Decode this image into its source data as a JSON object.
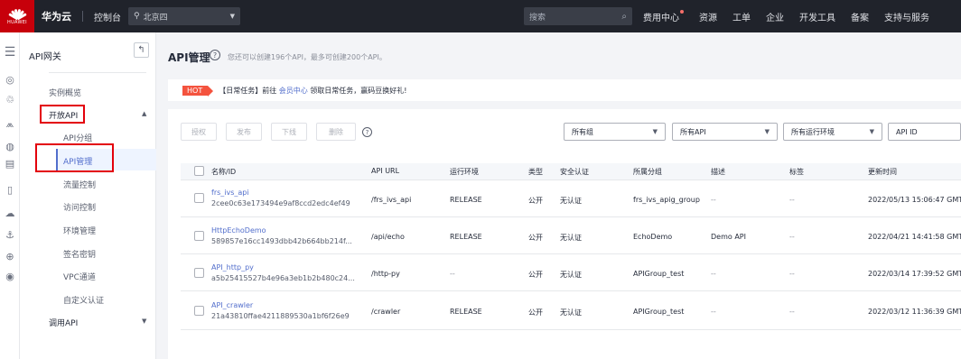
{
  "topbar": {
    "logo_text": "HUAWEI",
    "brand": "华为云",
    "console": "控制台",
    "region": "北京四",
    "search_placeholder": "搜索",
    "links": [
      "费用中心",
      "资源",
      "工单",
      "企业",
      "开发工具",
      "备案",
      "支持与服务"
    ]
  },
  "nav": {
    "title": "API网关",
    "items": {
      "overview": "实例概览",
      "open_api": "开放API",
      "api_group": "API分组",
      "api_manage": "API管理",
      "throttle": "流量控制",
      "access_control": "访问控制",
      "env_manage": "环境管理",
      "signature": "签名密钥",
      "vpc_channel": "VPC通道",
      "custom_auth": "自定义认证",
      "call_api": "调用API"
    }
  },
  "page": {
    "title": "API管理",
    "subtitle": "您还可以创建196个API，最多可创建200个API。"
  },
  "notice": {
    "badge": "HOT",
    "prefix": "【日常任务】前往",
    "link": "会员中心",
    "suffix": "领取日常任务，赢码豆换好礼!"
  },
  "toolbar": {
    "authorize": "授权",
    "publish": "发布",
    "offline": "下线",
    "delete": "删除"
  },
  "filters": {
    "group": "所有组",
    "api": "所有API",
    "env": "所有运行环境",
    "field": "API ID"
  },
  "table": {
    "headers": [
      "名称/ID",
      "API URL",
      "运行环境",
      "类型",
      "安全认证",
      "所属分组",
      "描述",
      "标签",
      "更新时间"
    ],
    "rows": [
      {
        "name": "frs_ivs_api",
        "id": "2cee0c63e173494e9af8ccd2edc4ef49",
        "url": "/frs_ivs_api",
        "env": "RELEASE",
        "type": "公开",
        "auth": "无认证",
        "group": "frs_ivs_apig_group",
        "desc": "--",
        "tag": "--",
        "updated": "2022/05/13 15:06:47 GMT+"
      },
      {
        "name": "HttpEchoDemo",
        "id": "589857e16cc1493dbb42b664bb214f...",
        "url": "/api/echo",
        "env": "RELEASE",
        "type": "公开",
        "auth": "无认证",
        "group": "EchoDemo",
        "desc": "Demo API",
        "tag": "--",
        "updated": "2022/04/21 14:41:58 GMT+"
      },
      {
        "name": "API_http_py",
        "id": "a5b25415527b4e96a3eb1b2b480c24...",
        "url": "/http-py",
        "env": "--",
        "type": "公开",
        "auth": "无认证",
        "group": "APIGroup_test",
        "desc": "--",
        "tag": "--",
        "updated": "2022/03/14 17:39:52 GMT+"
      },
      {
        "name": "API_crawler",
        "id": "21a43810ffae4211889530a1bf6f26e9",
        "url": "/crawler",
        "env": "RELEASE",
        "type": "公开",
        "auth": "无认证",
        "group": "APIGroup_test",
        "desc": "--",
        "tag": "--",
        "updated": "2022/03/12 11:36:39 GMT+"
      }
    ]
  }
}
